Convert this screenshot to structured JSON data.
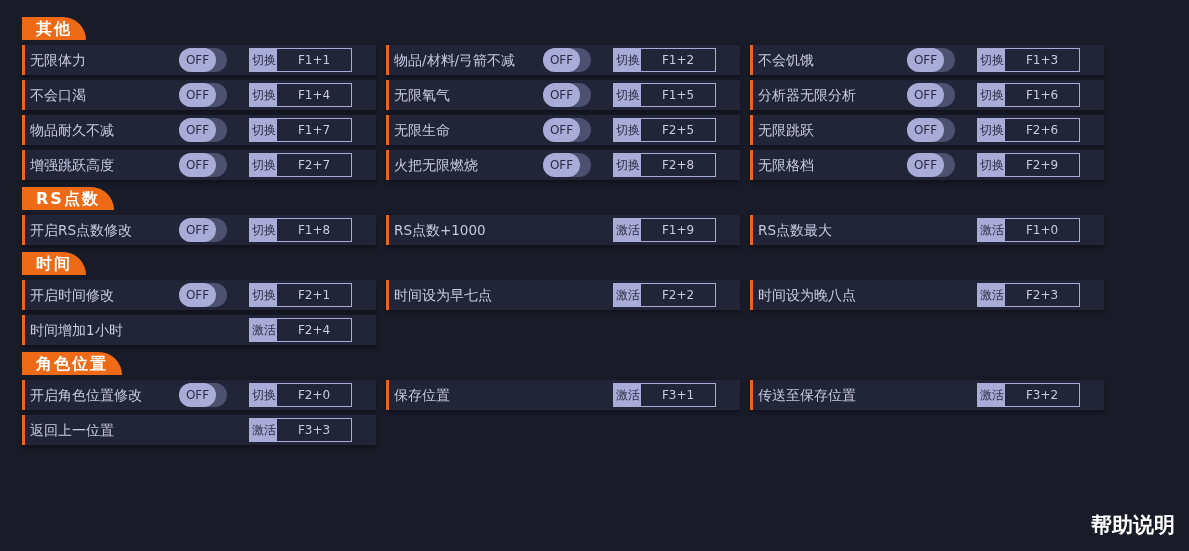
{
  "sections": [
    {
      "title": "其他",
      "items": [
        {
          "label": "无限体力",
          "kind": "toggle",
          "state": {
            "on": false,
            "text": "OFF"
          },
          "key_label": "切换",
          "hotkey": "F1+1"
        },
        {
          "label": "物品/材料/弓箭不减",
          "kind": "toggle",
          "state": {
            "on": false,
            "text": "OFF"
          },
          "key_label": "切换",
          "hotkey": "F1+2"
        },
        {
          "label": "不会饥饿",
          "kind": "toggle",
          "state": {
            "on": false,
            "text": "OFF"
          },
          "key_label": "切换",
          "hotkey": "F1+3"
        },
        {
          "label": "不会口渴",
          "kind": "toggle",
          "state": {
            "on": false,
            "text": "OFF"
          },
          "key_label": "切换",
          "hotkey": "F1+4"
        },
        {
          "label": "无限氧气",
          "kind": "toggle",
          "state": {
            "on": false,
            "text": "OFF"
          },
          "key_label": "切换",
          "hotkey": "F1+5"
        },
        {
          "label": "分析器无限分析",
          "kind": "toggle",
          "state": {
            "on": false,
            "text": "OFF"
          },
          "key_label": "切换",
          "hotkey": "F1+6"
        },
        {
          "label": "物品耐久不减",
          "kind": "toggle",
          "state": {
            "on": false,
            "text": "OFF"
          },
          "key_label": "切换",
          "hotkey": "F1+7"
        },
        {
          "label": "无限生命",
          "kind": "toggle",
          "state": {
            "on": false,
            "text": "OFF"
          },
          "key_label": "切换",
          "hotkey": "F2+5"
        },
        {
          "label": "无限跳跃",
          "kind": "toggle",
          "state": {
            "on": false,
            "text": "OFF"
          },
          "key_label": "切换",
          "hotkey": "F2+6"
        },
        {
          "label": "增强跳跃高度",
          "kind": "toggle",
          "state": {
            "on": false,
            "text": "OFF"
          },
          "key_label": "切换",
          "hotkey": "F2+7"
        },
        {
          "label": "火把无限燃烧",
          "kind": "toggle",
          "state": {
            "on": false,
            "text": "OFF"
          },
          "key_label": "切换",
          "hotkey": "F2+8"
        },
        {
          "label": "无限格档",
          "kind": "toggle",
          "state": {
            "on": false,
            "text": "OFF"
          },
          "key_label": "切换",
          "hotkey": "F2+9"
        }
      ]
    },
    {
      "title": "RS点数",
      "items": [
        {
          "label": "开启RS点数修改",
          "kind": "toggle",
          "state": {
            "on": false,
            "text": "OFF"
          },
          "key_label": "切换",
          "hotkey": "F1+8"
        },
        {
          "label": "RS点数+1000",
          "kind": "action",
          "key_label": "激活",
          "hotkey": "F1+9"
        },
        {
          "label": "RS点数最大",
          "kind": "action",
          "key_label": "激活",
          "hotkey": "F1+0"
        }
      ]
    },
    {
      "title": "时间",
      "items": [
        {
          "label": "开启时间修改",
          "kind": "toggle",
          "state": {
            "on": false,
            "text": "OFF"
          },
          "key_label": "切换",
          "hotkey": "F2+1"
        },
        {
          "label": "时间设为早七点",
          "kind": "action",
          "key_label": "激活",
          "hotkey": "F2+2"
        },
        {
          "label": "时间设为晚八点",
          "kind": "action",
          "key_label": "激活",
          "hotkey": "F2+3"
        },
        {
          "label": "时间增加1小时",
          "kind": "action",
          "key_label": "激活",
          "hotkey": "F2+4"
        }
      ]
    },
    {
      "title": "角色位置",
      "items": [
        {
          "label": "开启角色位置修改",
          "kind": "toggle",
          "state": {
            "on": false,
            "text": "OFF"
          },
          "key_label": "切换",
          "hotkey": "F2+0"
        },
        {
          "label": "保存位置",
          "kind": "action",
          "key_label": "激活",
          "hotkey": "F3+1"
        },
        {
          "label": "传送至保存位置",
          "kind": "action",
          "key_label": "激活",
          "hotkey": "F3+2"
        },
        {
          "label": "返回上一位置",
          "kind": "action",
          "key_label": "激活",
          "hotkey": "F3+3"
        }
      ]
    }
  ],
  "help_link": "帮助说明"
}
